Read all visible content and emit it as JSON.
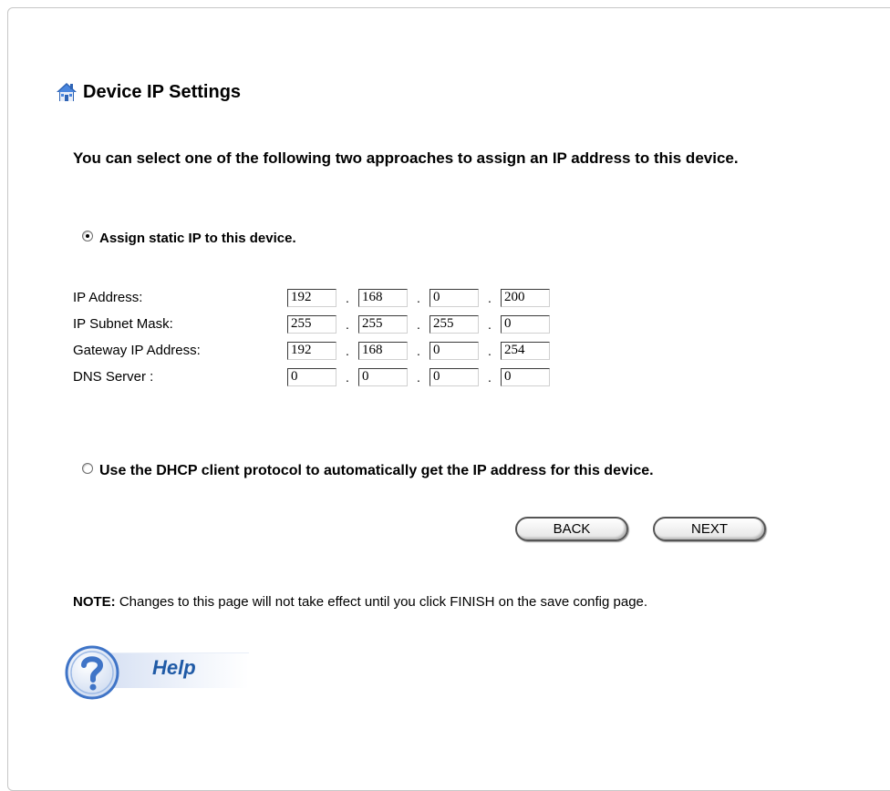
{
  "page": {
    "title": "Device IP Settings",
    "intro": "You can select one of the following two approaches to assign an IP address to this device."
  },
  "static_option": {
    "label": "Assign static IP to this device.",
    "checked": true
  },
  "ip_fields": [
    {
      "label": "IP Address:",
      "octets": [
        "192",
        "168",
        "0",
        "200"
      ]
    },
    {
      "label": "IP Subnet Mask:",
      "octets": [
        "255",
        "255",
        "255",
        "0"
      ]
    },
    {
      "label": "Gateway IP Address:",
      "octets": [
        "192",
        "168",
        "0",
        "254"
      ]
    },
    {
      "label": "DNS Server :",
      "octets": [
        "0",
        "0",
        "0",
        "0"
      ]
    }
  ],
  "separator": ".",
  "dhcp_option": {
    "label": "Use the DHCP client protocol to automatically get the IP address for this device.",
    "checked": false
  },
  "buttons": {
    "back": "BACK",
    "next": "NEXT"
  },
  "note": {
    "prefix": "NOTE:",
    "text": " Changes to this page will not take effect until you click FINISH on the save config page."
  },
  "help": {
    "label": "Help",
    "icon": "question-mark-icon"
  },
  "icons": {
    "title": "home-icon"
  },
  "colors": {
    "help_text": "#1f5aa6",
    "help_icon": "#3f74c7"
  }
}
